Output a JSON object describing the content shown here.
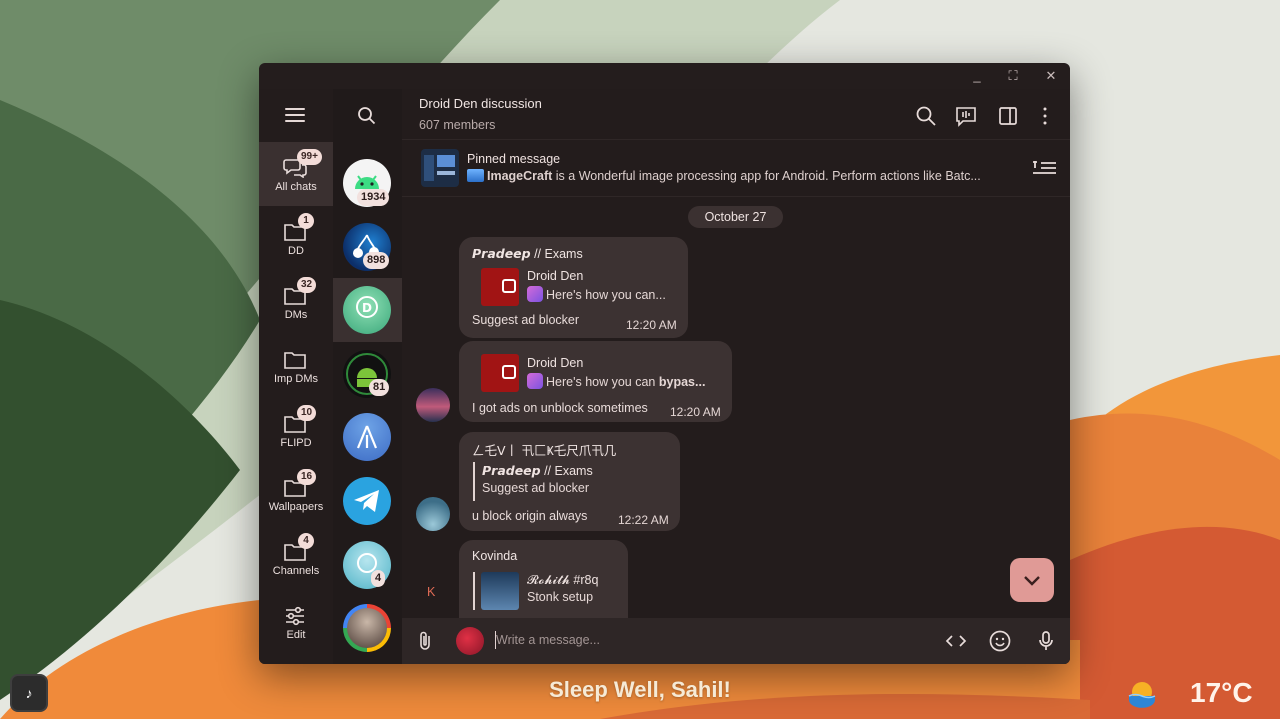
{
  "desktop": {
    "greeting": "Sleep Well, Sahil!",
    "temperature": "17°C",
    "weather_icon": "sun-sea-icon",
    "music_icon": "♪"
  },
  "window_controls": {
    "minimize": "_",
    "maximize": "⛶",
    "close": "✕"
  },
  "folders": [
    {
      "label": "All chats",
      "badge": "99+"
    },
    {
      "label": "DD",
      "badge": "1"
    },
    {
      "label": "DMs",
      "badge": "32"
    },
    {
      "label": "Imp DMs",
      "badge": ""
    },
    {
      "label": "FLIPD",
      "badge": "10"
    },
    {
      "label": "Wallpapers",
      "badge": "16"
    },
    {
      "label": "Channels",
      "badge": "4"
    },
    {
      "label": "Edit",
      "badge": ""
    }
  ],
  "chat_list": [
    {
      "badge": "1934"
    },
    {
      "badge": "898"
    },
    {
      "badge": ""
    },
    {
      "badge": "81"
    },
    {
      "badge": ""
    },
    {
      "badge": ""
    },
    {
      "badge": "4"
    },
    {
      "badge": ""
    }
  ],
  "header": {
    "title": "Droid Den discussion",
    "subtitle": "607 members"
  },
  "pinned": {
    "title": "Pinned message",
    "app_name": "ImageCraft",
    "text": " is a Wonderful image processing app for Android. Perform actions like Batc..."
  },
  "date_chip": "October 27",
  "messages": {
    "m1": {
      "sender": "𝙋𝙧𝙖𝙙𝙚𝙚𝙥 // Exams",
      "reply_name": "Droid Den",
      "reply_text": "Here's how you can...",
      "text": "Suggest ad blocker",
      "time": "12:20 AM"
    },
    "m2": {
      "reply_name": "Droid Den",
      "reply_text_prefix": "Here's how you can ",
      "reply_text_bold": "bypas...",
      "text": "I got ads on unblock sometimes",
      "time": "12:20 AM"
    },
    "m3": {
      "sender": "ㄥ乇ᐯ丨 卂匚Ҝ乇尺爪卂几",
      "quote_name": "𝙋𝙧𝙖𝙙𝙚𝙚𝙥 // Exams",
      "quote_text": "Suggest ad blocker",
      "text": "u block origin always",
      "time": "12:22 AM"
    },
    "m4": {
      "sender": "Kovinda",
      "reply_name_styled": "𝓡𝓸𝓱𝓲𝓽𝓱",
      "reply_name_tag": " #r8q",
      "reply_text": "Stonk setup",
      "avatar_letter": "K"
    }
  },
  "input": {
    "placeholder": "Write a message..."
  }
}
